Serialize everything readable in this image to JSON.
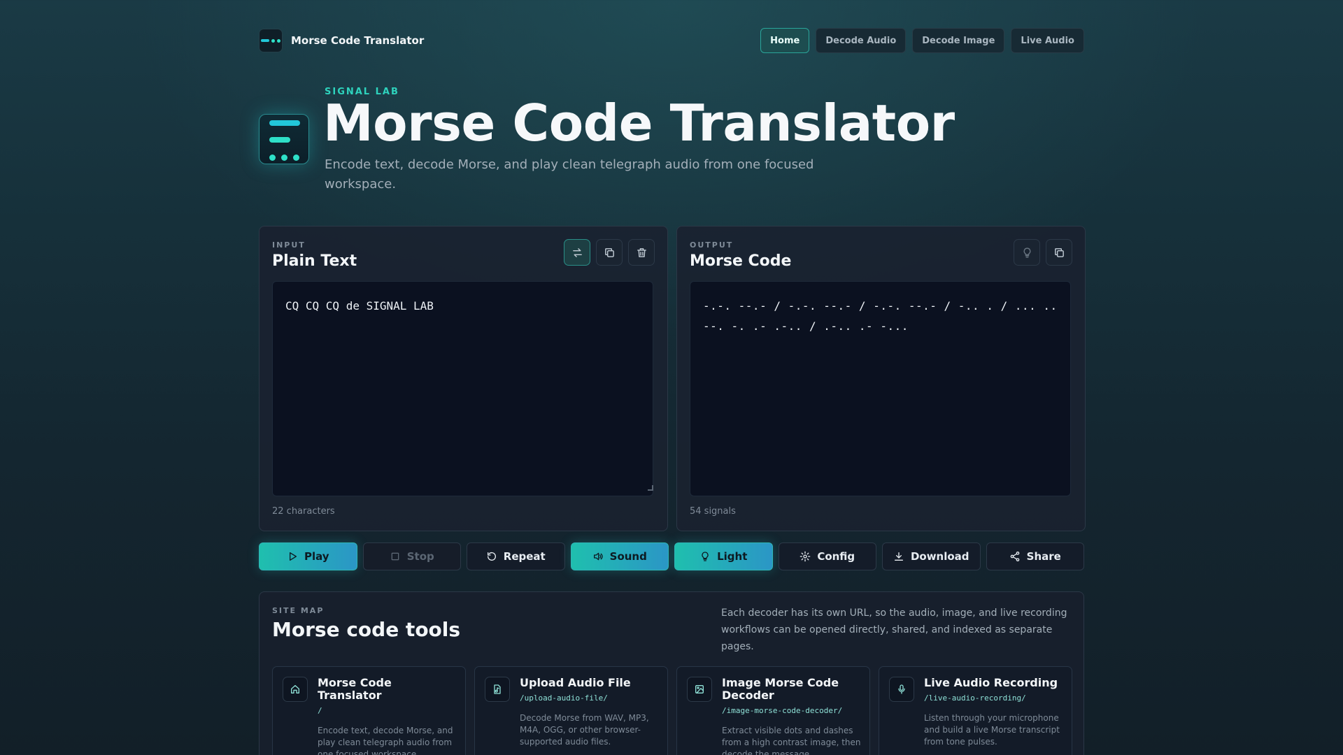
{
  "nav": {
    "brand": "Morse Code Translator",
    "links": [
      "Home",
      "Decode Audio",
      "Decode Image",
      "Live Audio"
    ],
    "active": "Home"
  },
  "hero": {
    "eyebrow": "SIGNAL LAB",
    "title": "Morse Code Translator",
    "subtitle": "Encode text, decode Morse, and play clean telegraph audio from one focused workspace."
  },
  "input_panel": {
    "eyebrow": "INPUT",
    "title": "Plain Text",
    "value": "CQ CQ CQ de SIGNAL LAB",
    "count": "22 characters",
    "tools": [
      "swap-icon",
      "copy-icon",
      "trash-icon"
    ]
  },
  "output_panel": {
    "eyebrow": "OUTPUT",
    "title": "Morse Code",
    "value": "-.-. --.- / -.-. --.- / -.-. --.- / -.. . / ... .. --. -. .- .-.. / .-.. .- -...",
    "count": "54 signals",
    "tools": [
      "lightbulb-icon",
      "copy-icon"
    ]
  },
  "actions": {
    "play": "Play",
    "stop": "Stop",
    "repeat": "Repeat",
    "sound": "Sound",
    "light": "Light",
    "config": "Config",
    "download": "Download",
    "share": "Share"
  },
  "sitemap": {
    "eyebrow": "SITE MAP",
    "title": "Morse code tools",
    "description": "Each decoder has its own URL, so the audio, image, and live recording workflows can be opened directly, shared, and indexed as separate pages.",
    "cards": [
      {
        "title": "Morse Code Translator",
        "path": "/",
        "desc": "Encode text, decode Morse, and play clean telegraph audio from one focused workspace.",
        "icon": "home-icon"
      },
      {
        "title": "Upload Audio File",
        "path": "/upload-audio-file/",
        "desc": "Decode Morse from WAV, MP3, M4A, OGG, or other browser-supported audio files.",
        "icon": "audio-file-icon"
      },
      {
        "title": "Image Morse Code Decoder",
        "path": "/image-morse-code-decoder/",
        "desc": "Extract visible dots and dashes from a high contrast image, then decode the message.",
        "icon": "image-icon"
      },
      {
        "title": "Live Audio Recording",
        "path": "/live-audio-recording/",
        "desc": "Listen through your microphone and build a live Morse transcript from tone pulses.",
        "icon": "microphone-icon"
      }
    ]
  },
  "colors": {
    "accent": "#2ed3bd",
    "accent_gradient_start": "#1fbfae",
    "accent_gradient_end": "#2b96c6",
    "background": "#16303a",
    "panel": "#1a2230",
    "textbox": "#0b1120"
  }
}
